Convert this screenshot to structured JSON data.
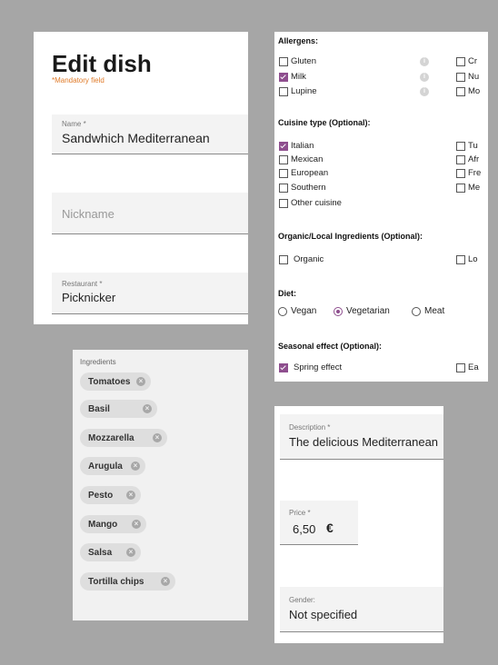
{
  "edit": {
    "title": "Edit dish",
    "mandatory": "*Mandatory field",
    "name_label": "Name *",
    "name_value": "Sandwhich Mediterranean",
    "nickname_placeholder": "Nickname",
    "restaurant_label": "Restaurant *",
    "restaurant_value": "Picknicker"
  },
  "allergens": {
    "heading": "Allergens:",
    "items": [
      {
        "label": "Gluten",
        "checked": false
      },
      {
        "label": "Milk",
        "checked": true
      },
      {
        "label": "Lupine",
        "checked": false
      },
      {
        "label": "Cr",
        "checked": false
      },
      {
        "label": "Nu",
        "checked": false
      },
      {
        "label": "Mo",
        "checked": false
      }
    ],
    "info_icon": "i"
  },
  "cuisine": {
    "heading": "Cuisine type (Optional):",
    "items": [
      {
        "label": "Italian",
        "checked": true
      },
      {
        "label": "Mexican",
        "checked": false
      },
      {
        "label": "European",
        "checked": false
      },
      {
        "label": "Southern",
        "checked": false
      },
      {
        "label": "Other cuisine",
        "checked": false
      },
      {
        "label": "Tu",
        "checked": false
      },
      {
        "label": "Afr",
        "checked": false
      },
      {
        "label": "Fre",
        "checked": false
      },
      {
        "label": "Me",
        "checked": false
      }
    ]
  },
  "organic": {
    "heading": "Organic/Local Ingredients (Optional):",
    "items": [
      {
        "label": "Organic",
        "checked": false
      },
      {
        "label": "Lo",
        "checked": false
      }
    ]
  },
  "diet": {
    "heading": "Diet:",
    "options": [
      "Vegan",
      "Vegetarian",
      "Meat"
    ],
    "selected": "Vegetarian"
  },
  "seasonal": {
    "heading": "Seasonal effect (Optional):",
    "items": [
      {
        "label": "Spring effect",
        "checked": true
      },
      {
        "label": "Ea",
        "checked": false
      }
    ]
  },
  "ingredients": {
    "label": "Ingredients",
    "chips": [
      "Tomatoes",
      "Basil",
      "Mozzarella",
      "Arugula",
      "Pesto",
      "Mango",
      "Salsa",
      "Tortilla chips"
    ],
    "remove_icon": "×"
  },
  "details": {
    "description_label": "Description *",
    "description_value": "The delicious Mediterranean",
    "price_label": "Price *",
    "price_value": "6,50",
    "currency": "€",
    "gender_label": "Gender:",
    "gender_value": "Not specified"
  },
  "colors": {
    "accent": "#8e4e8e",
    "mandatory": "#e07b2a",
    "background": "#a6a6a6"
  }
}
